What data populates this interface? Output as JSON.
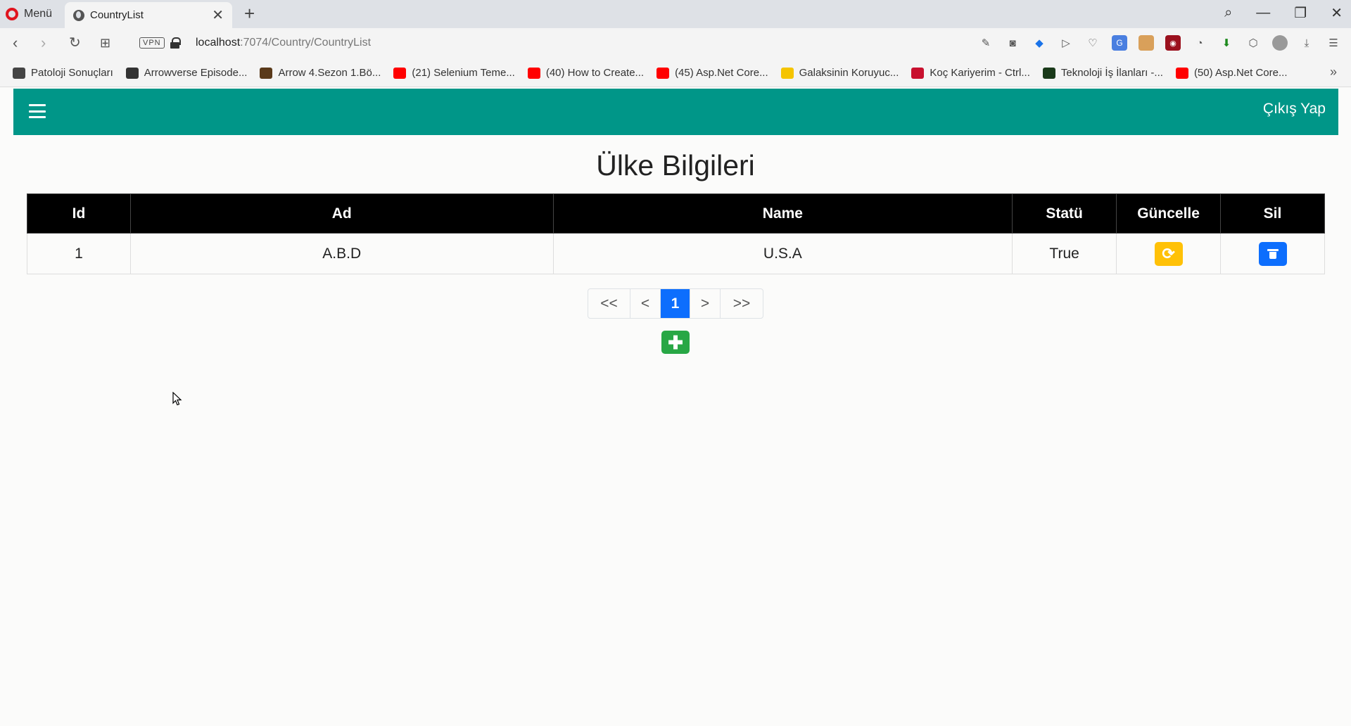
{
  "browser": {
    "menu_label": "Menü",
    "tab_title": "CountryList",
    "url_host": "localhost",
    "url_path": ":7074/Country/CountryList",
    "vpn_label": "VPN",
    "bookmarks": [
      {
        "label": "Patoloji Sonuçları",
        "icon_color": "#444444"
      },
      {
        "label": "Arrowverse Episode...",
        "icon_color": "#333333"
      },
      {
        "label": "Arrow 4.Sezon 1.Bö...",
        "icon_color": "#5a3a1a"
      },
      {
        "label": "(21) Selenium Teme...",
        "icon_color": "#ff0000"
      },
      {
        "label": "(40) How to Create...",
        "icon_color": "#ff0000"
      },
      {
        "label": "(45) Asp.Net Core...",
        "icon_color": "#ff0000"
      },
      {
        "label": "Galaksinin Koruyuc...",
        "icon_color": "#f5c400"
      },
      {
        "label": "Koç Kariyerim - Ctrl...",
        "icon_color": "#c8102e"
      },
      {
        "label": "Teknoloji İş İlanları -...",
        "icon_color": "#1a3a1a"
      },
      {
        "label": "(50) Asp.Net Core...",
        "icon_color": "#ff0000"
      }
    ]
  },
  "navbar": {
    "logout_label": "Çıkış Yap",
    "color": "#009688"
  },
  "page": {
    "title": "Ülke Bilgileri"
  },
  "table": {
    "headers": [
      "Id",
      "Ad",
      "Name",
      "Statü",
      "Güncelle",
      "Sil"
    ],
    "rows": [
      {
        "id": "1",
        "ad": "A.B.D",
        "name": "U.S.A",
        "status": "True"
      }
    ]
  },
  "pagination": {
    "first": "<<",
    "prev": "<",
    "current": "1",
    "next": ">",
    "last": ">>"
  },
  "colors": {
    "update_button": "#ffc107",
    "delete_button": "#0d6efd",
    "add_button": "#28a745",
    "active_page": "#0d6efd"
  }
}
